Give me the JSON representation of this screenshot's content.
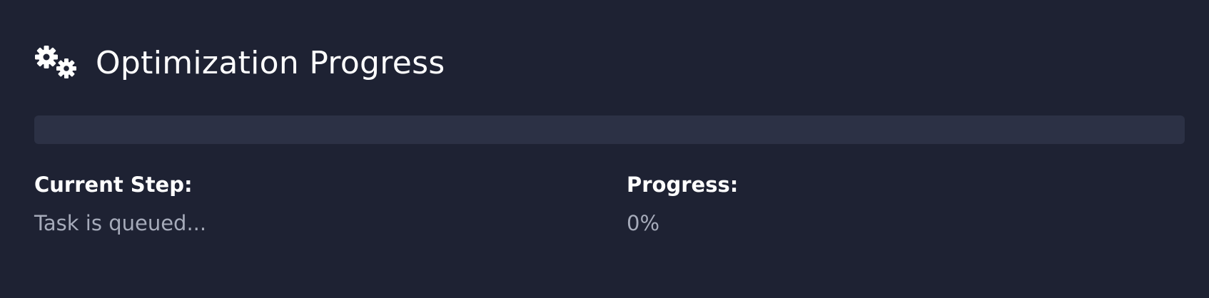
{
  "header": {
    "icon": "gears-icon",
    "title": "Optimization Progress"
  },
  "progress_bar": {
    "value_percent": 0,
    "track_color": "#2c3145",
    "fill_color": "#4f7cff"
  },
  "current_step": {
    "label": "Current Step:",
    "value": "Task is queued..."
  },
  "progress": {
    "label": "Progress:",
    "value": "0%"
  },
  "colors": {
    "background": "#1e2233",
    "text_primary": "#ffffff",
    "text_secondary": "#a6abba"
  }
}
